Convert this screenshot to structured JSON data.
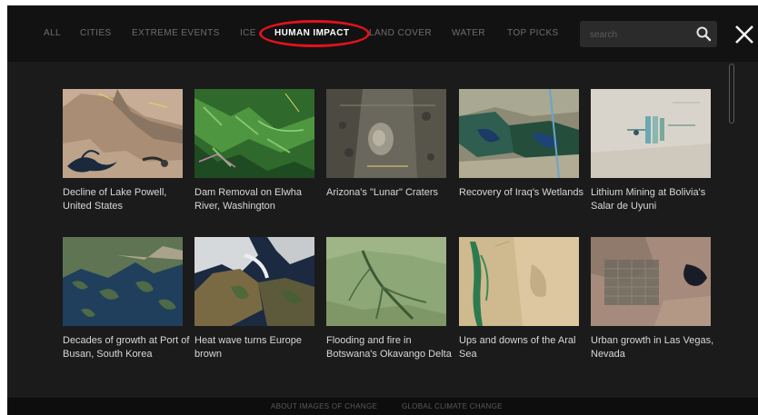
{
  "nav": {
    "items": [
      "ALL",
      "CITIES",
      "EXTREME EVENTS",
      "ICE",
      "HUMAN IMPACT",
      "LAND COVER",
      "WATER",
      "TOP PICKS"
    ],
    "active": "HUMAN IMPACT"
  },
  "search": {
    "placeholder": "search",
    "icon": "search-icon"
  },
  "close": {
    "icon": "close-icon"
  },
  "gallery": {
    "items": [
      {
        "caption": "Decline of Lake Powell, United States"
      },
      {
        "caption": "Dam Removal on Elwha River, Washington"
      },
      {
        "caption": "Arizona's \"Lunar\" Craters"
      },
      {
        "caption": "Recovery of Iraq's Wetlands"
      },
      {
        "caption": "Lithium Mining at Bolivia's Salar de Uyuni"
      },
      {
        "caption": "Decades of growth at Port of Busan, South Korea"
      },
      {
        "caption": "Heat wave turns Europe brown"
      },
      {
        "caption": "Flooding and fire in Botswana's Okavango Delta"
      },
      {
        "caption": "Ups and downs of the Aral Sea"
      },
      {
        "caption": "Urban growth in Las Vegas, Nevada"
      }
    ]
  },
  "footer": {
    "links": [
      "ABOUT IMAGES OF CHANGE",
      "GLOBAL CLIMATE CHANGE"
    ]
  },
  "colors": {
    "highlight": "#e0121b",
    "background": "#1b1b1b",
    "topbar": "#121212",
    "text": "#d8d8d8",
    "nav_inactive": "#6d6d6d"
  }
}
